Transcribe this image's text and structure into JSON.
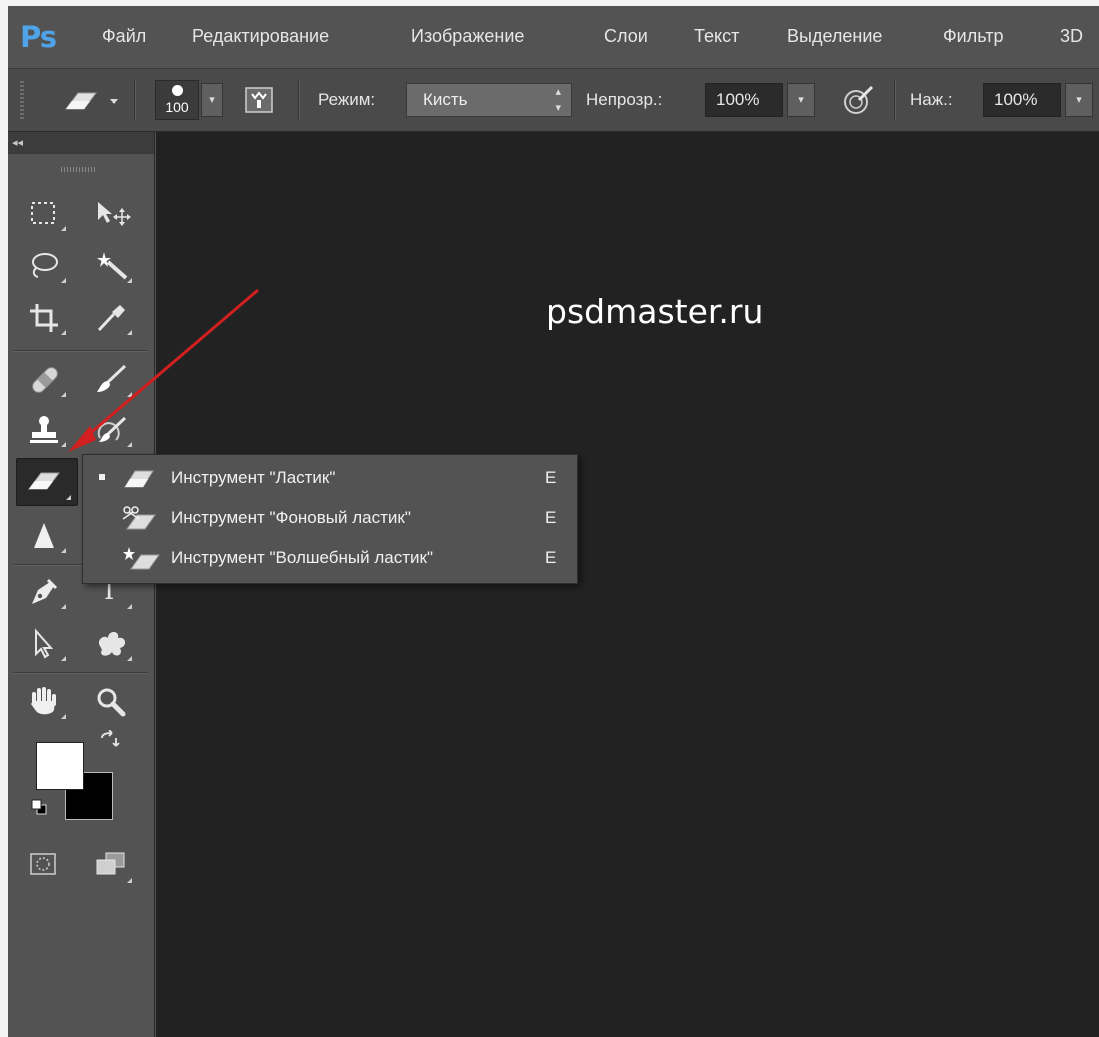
{
  "menubar": {
    "logo": "Ps",
    "items": [
      "Файл",
      "Редактирование",
      "Изображение",
      "Слои",
      "Текст",
      "Выделение",
      "Фильтр",
      "3D"
    ]
  },
  "options": {
    "brush_size": "100",
    "mode_label": "Режим:",
    "mode_value": "Кисть",
    "opacity_label": "Непрозр.:",
    "opacity_value": "100%",
    "pressure_label": "Наж.:",
    "pressure_value": "100%"
  },
  "toolbox": {
    "collapse_glyph": "◂◂",
    "tools": [
      {
        "name": "rectangular-marquee",
        "icon": "marquee-icon"
      },
      {
        "name": "move",
        "icon": "move-icon"
      },
      {
        "name": "lasso",
        "icon": "lasso-icon"
      },
      {
        "name": "magic-wand",
        "icon": "magic-wand-icon"
      },
      {
        "name": "crop",
        "icon": "crop-icon"
      },
      {
        "name": "eyedropper",
        "icon": "eyedropper-icon"
      },
      {
        "name": "healing-brush",
        "icon": "bandage-icon"
      },
      {
        "name": "brush",
        "icon": "brush-icon"
      },
      {
        "name": "clone-stamp",
        "icon": "stamp-icon"
      },
      {
        "name": "history-brush",
        "icon": "history-brush-icon"
      },
      {
        "name": "eraser",
        "icon": "eraser-icon"
      },
      {
        "name": "sharpen",
        "icon": "sharpen-icon"
      },
      {
        "name": "pen",
        "icon": "pen-icon"
      },
      {
        "name": "type",
        "icon": "type-icon"
      },
      {
        "name": "path-selection",
        "icon": "arrow-icon"
      },
      {
        "name": "custom-shape",
        "icon": "shape-icon"
      },
      {
        "name": "hand",
        "icon": "hand-icon"
      },
      {
        "name": "zoom",
        "icon": "zoom-icon"
      }
    ],
    "type_glyph": "I",
    "foreground_color": "#ffffff",
    "background_color": "#000000"
  },
  "canvas": {
    "watermark": "psdmaster.ru"
  },
  "flyout": {
    "items": [
      {
        "label": "Инструмент \"Ластик\"",
        "key": "E",
        "selected": true
      },
      {
        "label": "Инструмент \"Фоновый ластик\"",
        "key": "E",
        "selected": false
      },
      {
        "label": "Инструмент \"Волшебный ластик\"",
        "key": "E",
        "selected": false
      }
    ]
  },
  "colors": {
    "accent_logo": "#4fa3e8",
    "annotation_arrow": "#d21f1f",
    "ui_panel": "#535353",
    "canvas": "#222222"
  }
}
